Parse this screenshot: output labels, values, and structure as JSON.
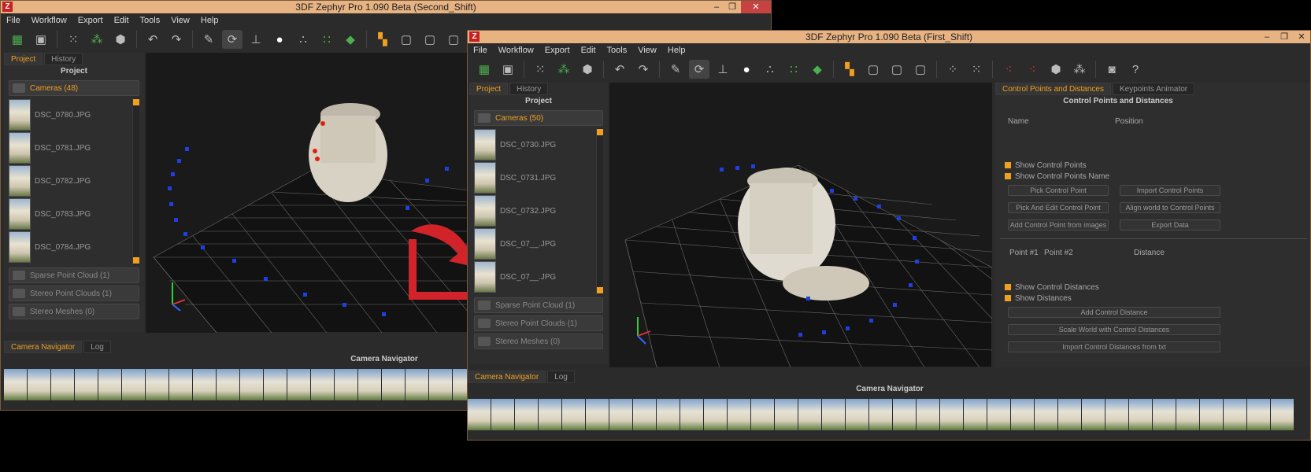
{
  "colors": {
    "accent": "#f0a020",
    "title_bar": "#e8b382",
    "close": "#c74343",
    "arrow": "#d2232a"
  },
  "menu": [
    "File",
    "Workflow",
    "Export",
    "Edit",
    "Tools",
    "View",
    "Help"
  ],
  "win_back": {
    "title": "3DF Zephyr Pro 1.090 Beta (Second_Shift)",
    "tabs": [
      "Project",
      "History"
    ],
    "panel_title": "Project",
    "cameras_label": "Cameras (48)",
    "cameras": [
      "DSC_0780.JPG",
      "DSC_0781.JPG",
      "DSC_0782.JPG",
      "DSC_0783.JPG",
      "DSC_0784.JPG"
    ],
    "sparse": "Sparse Point Cloud (1)",
    "stereo": "Stereo Point Clouds (1)",
    "meshes": "Stereo Meshes (0)",
    "bottom_tabs": [
      "Camera Navigator",
      "Log"
    ],
    "nav_title": "Camera Navigator"
  },
  "win_front": {
    "title": "3DF Zephyr Pro 1.090 Beta (First_Shift)",
    "tabs": [
      "Project",
      "History"
    ],
    "panel_title": "Project",
    "cameras_label": "Cameras (50)",
    "cameras": [
      "DSC_0730.JPG",
      "DSC_0731.JPG",
      "DSC_0732.JPG",
      "DSC_07__.JPG",
      "DSC_07__.JPG"
    ],
    "sparse": "Sparse Point Cloud (1)",
    "stereo": "Stereo Point Clouds (1)",
    "meshes": "Stereo Meshes (0)",
    "bottom_tabs": [
      "Camera Navigator",
      "Log"
    ],
    "nav_title": "Camera Navigator",
    "right_tabs": [
      "Control Points and Distances",
      "Keypoints Animator"
    ],
    "right_title": "Control Points and Distances",
    "col_name": "Name",
    "col_position": "Position",
    "show_cp": "Show Control Points",
    "show_cp_name": "Show Control Points Name",
    "btn_pick": "Pick Control Point",
    "btn_import": "Import Control Points",
    "btn_pick_edit": "Pick And Edit Control Point",
    "btn_align": "Align world to Control Points",
    "btn_add_img": "Add Control Point from images",
    "btn_export": "Export Data",
    "col_p1": "Point #1",
    "col_p2": "Point #2",
    "col_dist": "Distance",
    "show_cd": "Show Control Distances",
    "show_dist": "Show Distances",
    "btn_add_dist": "Add Control Distance",
    "btn_scale": "Scale World with Control Distances",
    "btn_import_txt": "Import Control Distances from txt"
  }
}
